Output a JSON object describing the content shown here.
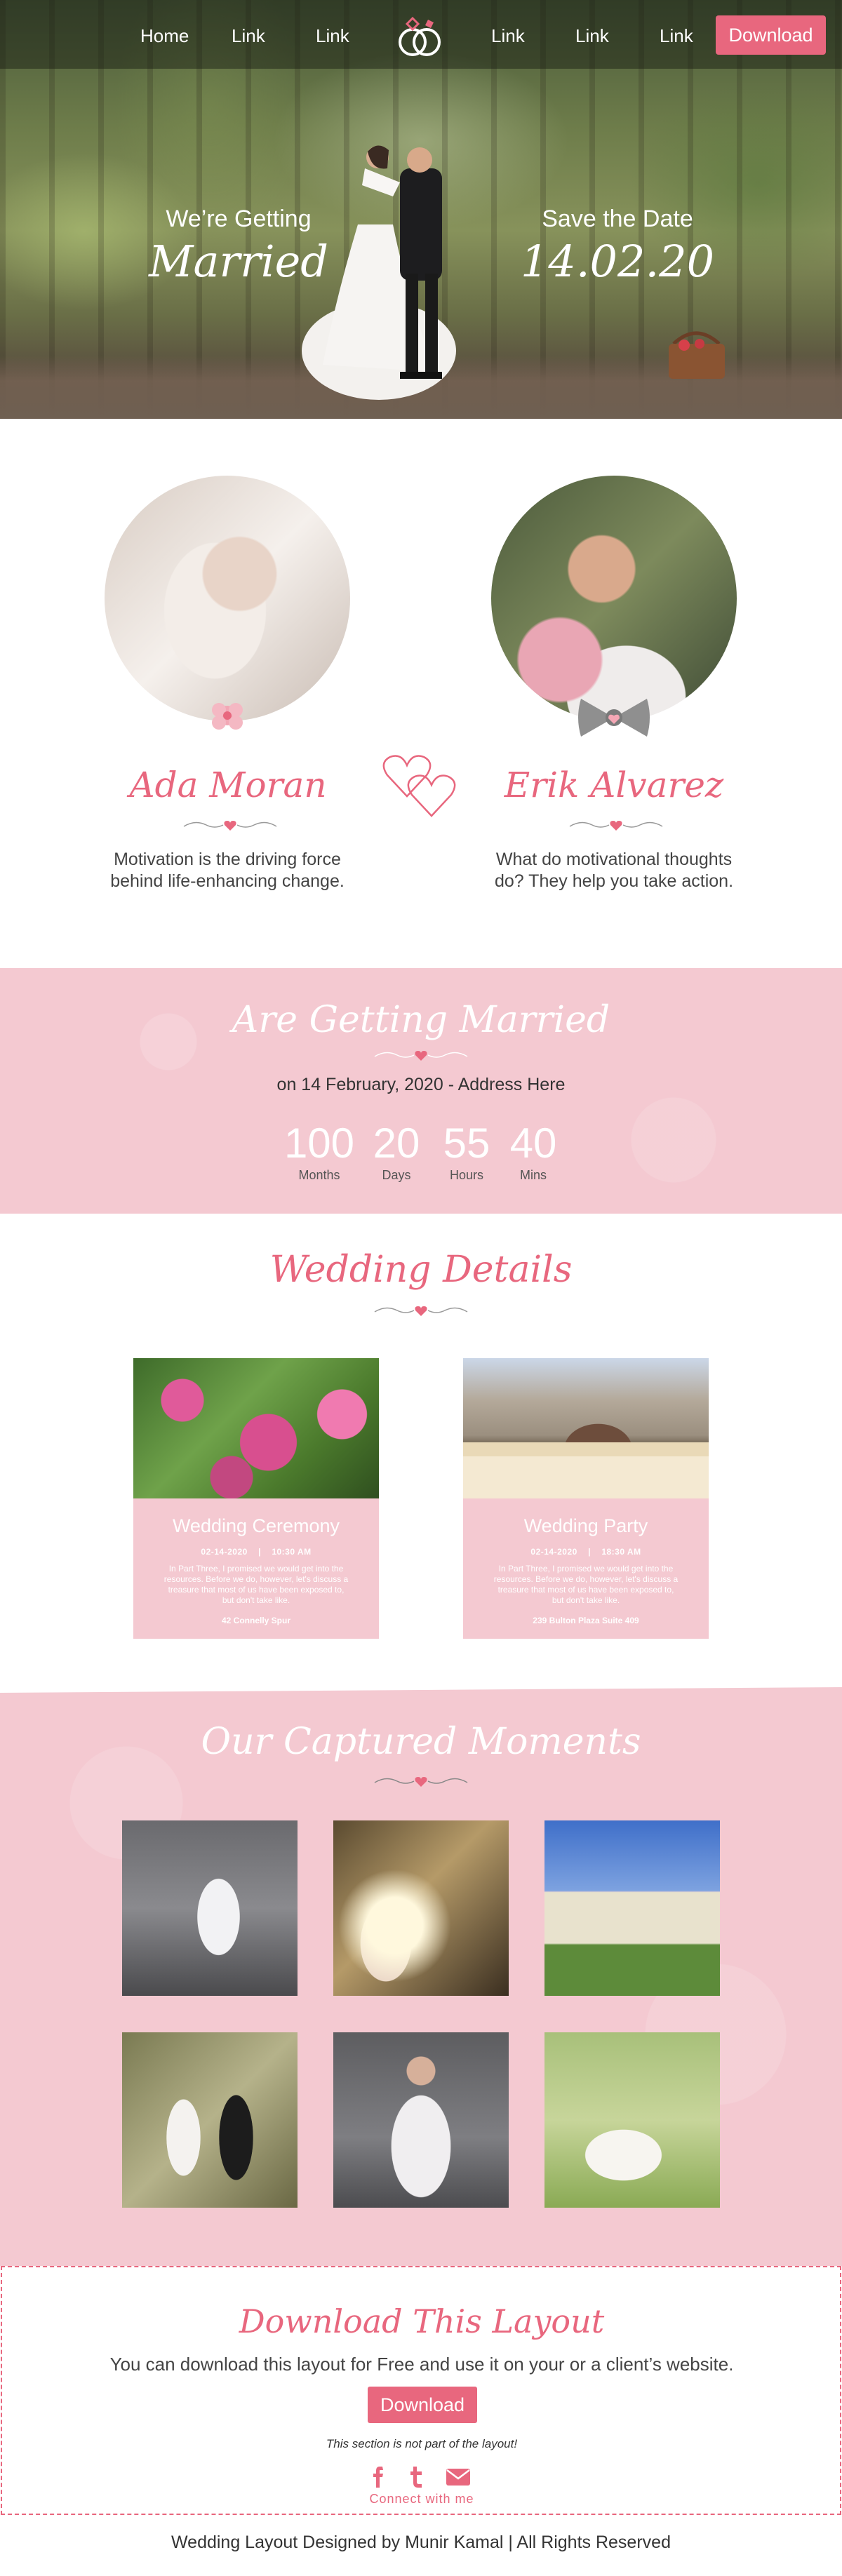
{
  "nav": {
    "home": "Home",
    "link1": "Link",
    "link2": "Link",
    "link3": "Link",
    "link4": "Link",
    "link5": "Link",
    "download": "Download",
    "logo_icon": "wedding-rings-icon"
  },
  "hero": {
    "left_small": "We’re  Getting",
    "left_big": "Married",
    "right_small": "Save the Date",
    "right_big": "14.02.20"
  },
  "bride": {
    "name": "Ada Moran",
    "quote": "Motivation is the driving force behind life-enhancing change."
  },
  "groom": {
    "name": "Erik Alvarez",
    "quote": "What do motivational thoughts do? They help you take action."
  },
  "countdown": {
    "title": "Are Getting Married",
    "subtitle": "on 14 February, 2020 - Address Here",
    "units": [
      {
        "value": "100",
        "label": "Months"
      },
      {
        "value": "20",
        "label": "Days"
      },
      {
        "value": "55",
        "label": "Hours"
      },
      {
        "value": "40",
        "label": "Mins"
      }
    ]
  },
  "details": {
    "title": "Wedding Details",
    "cards": [
      {
        "title": "Wedding Ceremony",
        "date": "02-14-2020",
        "time": "10:30 AM",
        "text": "In Part Three, I promised we would get into the resources. Before we do, however, let's discuss a treasure that most of us have been exposed to, but don't take like.",
        "address": "42 Connelly Spur"
      },
      {
        "title": "Wedding Party",
        "date": "02-14-2020",
        "time": "18:30 AM",
        "text": "In Part Three, I promised we would get into the resources. Before we do, however, let's discuss a treasure that most of us have been exposed to, but don't take like.",
        "address": "239 Bulton Plaza Suite 409"
      }
    ]
  },
  "moments": {
    "title": "Our Captured Moments"
  },
  "download_section": {
    "title": "Download This Layout",
    "text": "You can download this layout for Free and use it on your or a client’s website.",
    "button": "Download",
    "note": "This section is not part of the layout!",
    "social": [
      "facebook-icon",
      "twitter-icon",
      "envelope-icon"
    ],
    "connect": "Connect with me"
  },
  "footer": {
    "text": "Wedding Layout Designed by Munir Kamal | All Rights Reserved"
  },
  "colors": {
    "accent": "#e8677e",
    "pink_bg": "#f4c9d1"
  }
}
